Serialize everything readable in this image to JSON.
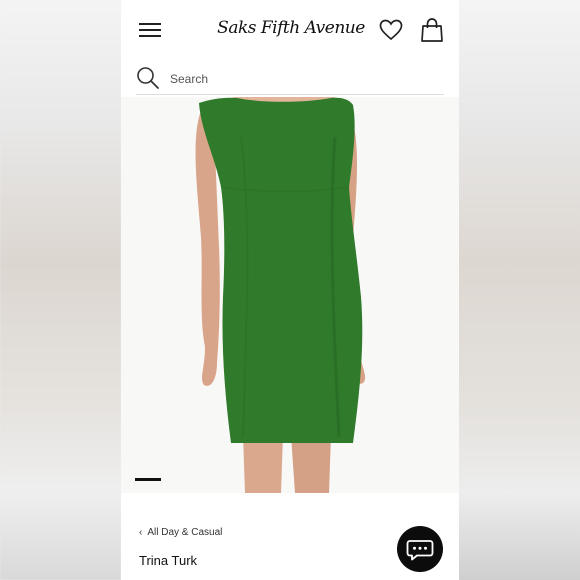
{
  "header": {
    "logo_text": "Saks Fifth Avenue",
    "icons": [
      "menu-icon",
      "heart-icon",
      "shopping-bag-icon"
    ]
  },
  "search": {
    "placeholder": "Search"
  },
  "product": {
    "image_alt": "green sleeveless shift dress",
    "dress_color": "#2f7a2b",
    "breadcrumb": "All Day & Casual",
    "brand": "Trina Turk"
  },
  "carousel": {
    "current_index": 1
  },
  "chat": {
    "icon": "chat-bubble-icon"
  }
}
